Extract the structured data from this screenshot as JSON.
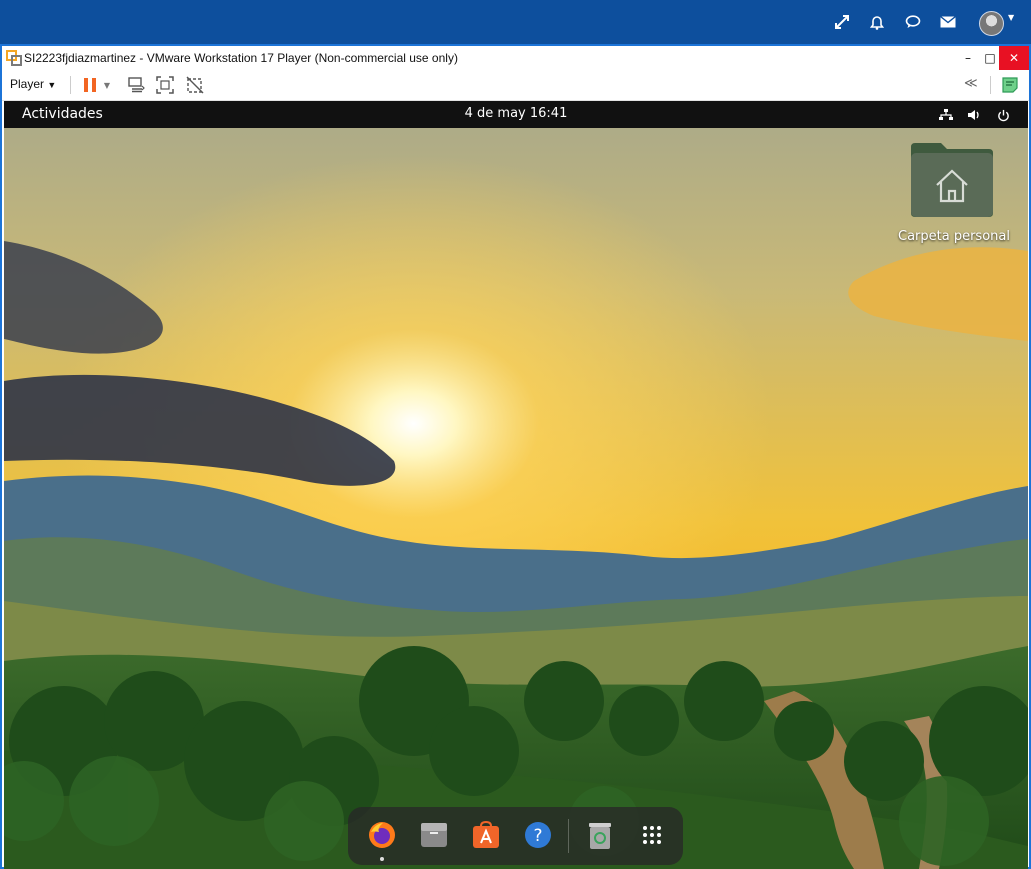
{
  "host": {
    "topbar_icons": [
      "expand-icon",
      "bell-icon",
      "chat-icon",
      "mail-icon",
      "user-avatar"
    ]
  },
  "vmware": {
    "title": "SI2223fjdiazmartinez - VMware Workstation 17 Player (Non-commercial use only)",
    "player_menu": "Player",
    "window_buttons": {
      "minimize": "–",
      "maximize": "□",
      "close": "✕"
    },
    "collapse": "≪"
  },
  "guest": {
    "activities": "Actividades",
    "clock": "4 de may  16:41",
    "desktop_icon_label": "Carpeta personal",
    "dock": [
      "firefox",
      "files",
      "software",
      "help",
      "trash",
      "show-apps"
    ]
  },
  "colors": {
    "host_bar": "#0d4f9d",
    "vm_border": "#1c74d8",
    "pause_orange": "#f26522",
    "close_red": "#e81123"
  }
}
